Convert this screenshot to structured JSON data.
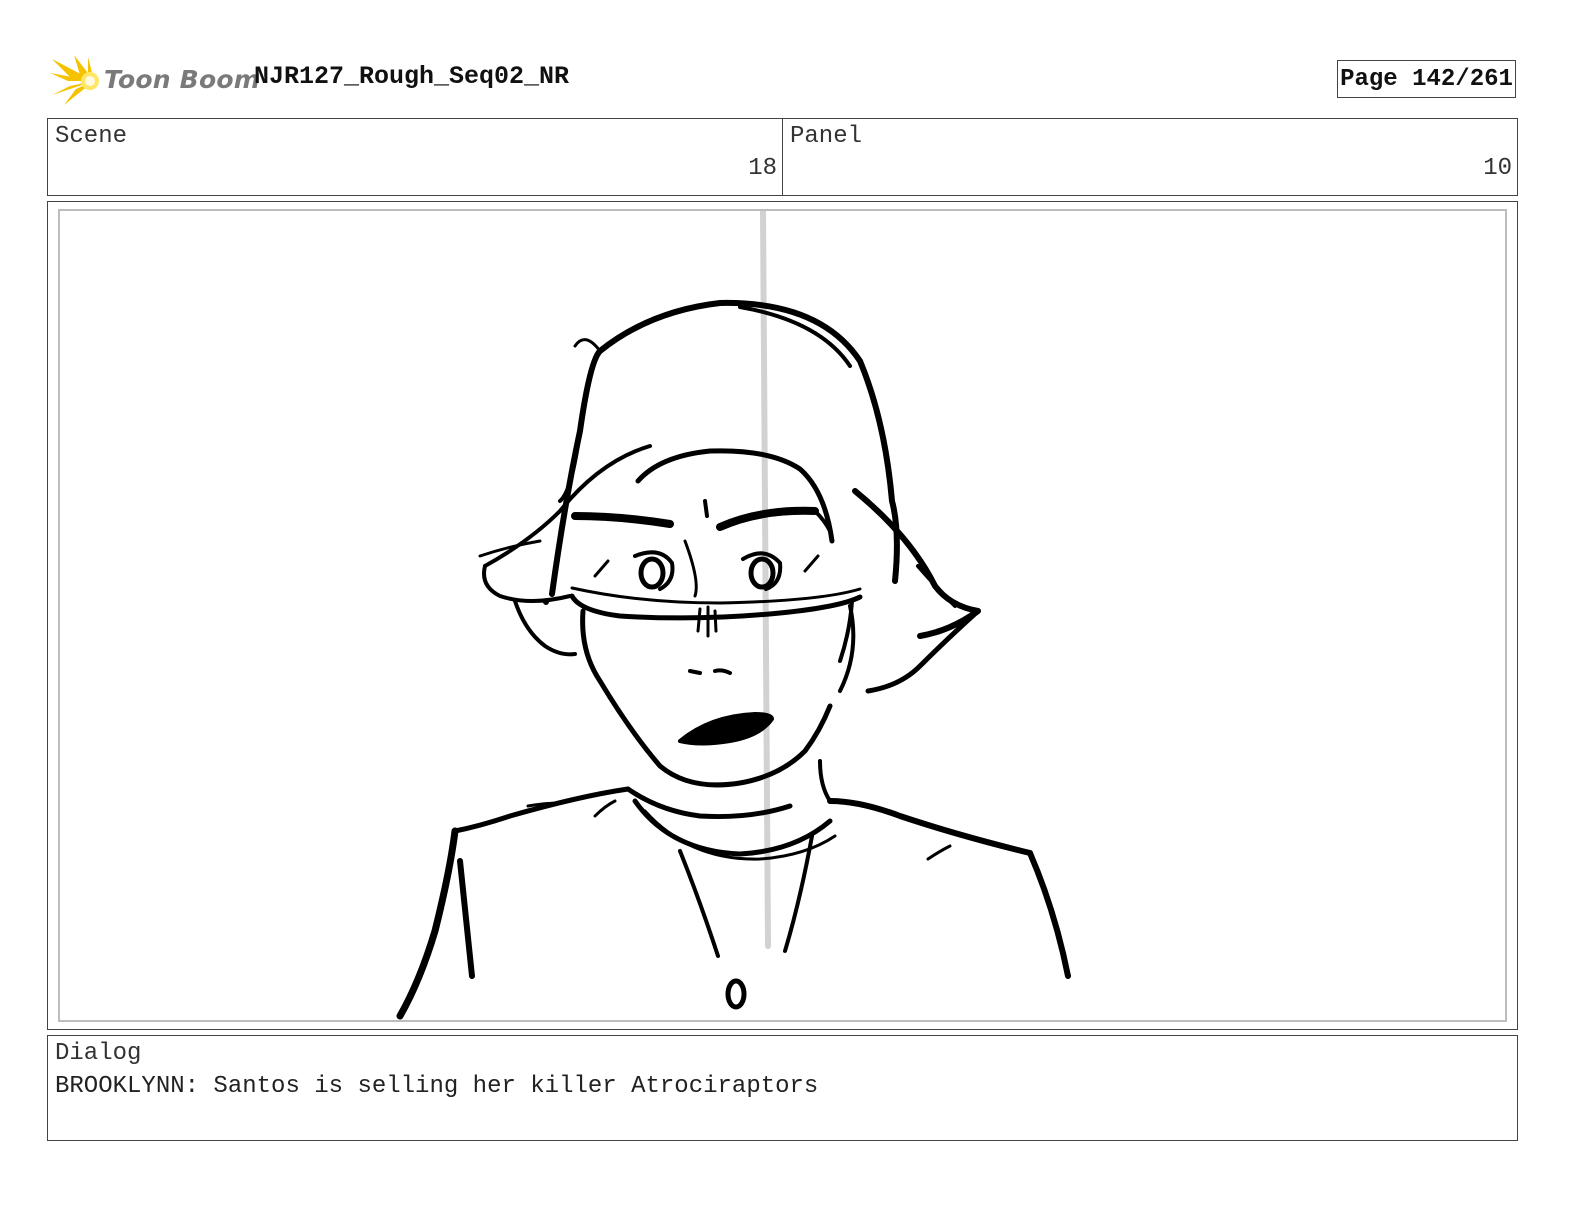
{
  "header": {
    "brand": "Toon Boom",
    "brand_colors": {
      "burst": "#f5c200",
      "burst_core": "#ffe766",
      "text": "#7a7a7a"
    },
    "doc_title": "NJR127_Rough_Seq02_NR",
    "page_label": "Page 142/261"
  },
  "info": {
    "scene_label": "Scene",
    "scene_value": "18",
    "panel_label": "Panel",
    "panel_value": "10"
  },
  "sketch": {
    "description_icon": "character-sketch",
    "stroke_color": "#000000",
    "guide_color": "#d2d2d2"
  },
  "dialog": {
    "label": "Dialog",
    "text": "BROOKLYNN: Santos is selling her killer Atrociraptors"
  }
}
